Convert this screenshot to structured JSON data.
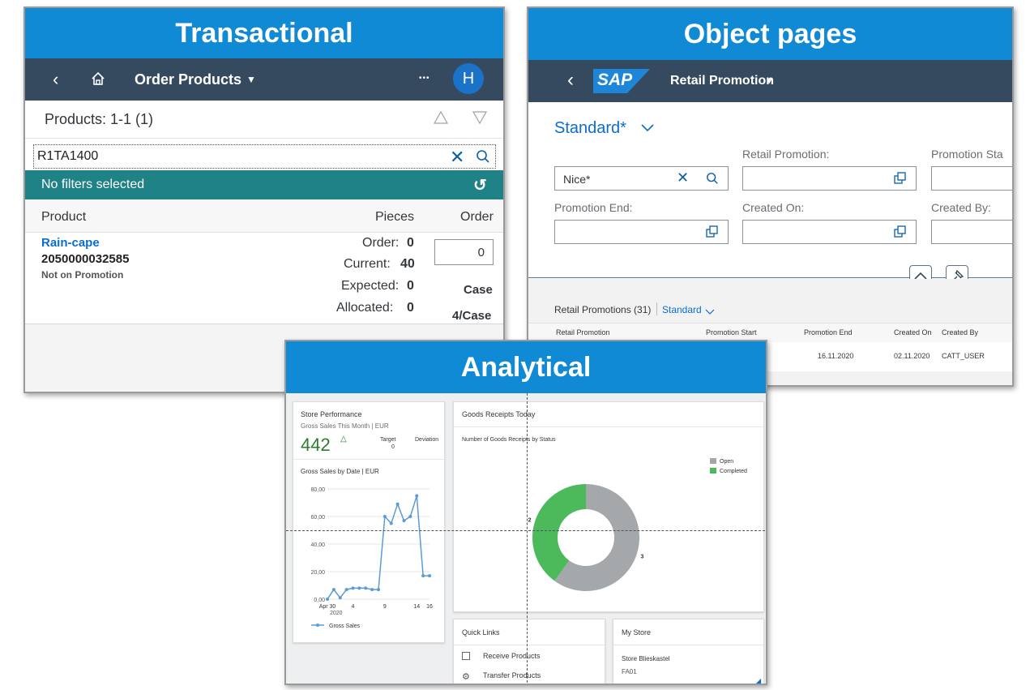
{
  "transactional": {
    "banner": "Transactional",
    "shell": {
      "title": "Order Products",
      "more": "•••",
      "avatar": "H"
    },
    "products_header": "Products: 1-1 (1)",
    "search_value": "R1TA1400",
    "filter_bar": "No filters selected",
    "columns": {
      "product": "Product",
      "pieces": "Pieces",
      "order": "Order"
    },
    "item": {
      "name": "Rain-cape",
      "number": "2050000032585",
      "status": "Not on Promotion",
      "order_label": "Order:",
      "order_value": "0",
      "current_label": "Current:",
      "current_value": "40",
      "expected_label": "Expected:",
      "expected_value": "0",
      "allocated_label": "Allocated:",
      "allocated_value": "0",
      "order_input": "0",
      "unit": "Case",
      "pack": "4/Case"
    }
  },
  "object_pages": {
    "banner": "Object pages",
    "shell": {
      "logo": "SAP",
      "title": "Retail Promotion"
    },
    "variant": "Standard*",
    "labels": {
      "retail_promotion": "Retail Promotion:",
      "promotion_start": "Promotion Sta",
      "promotion_end": "Promotion End:",
      "created_on": "Created On:",
      "created_by": "Created By:"
    },
    "search_value": "Nice*",
    "table_title": "Retail Promotions (31)",
    "table_variant": "Standard",
    "columns": [
      "Retail Promotion",
      "Promotion Start",
      "Promotion End",
      "Created On",
      "Created By"
    ],
    "row": {
      "promotion_end": "16.11.2020",
      "created_on": "02.11.2020",
      "created_by": "CATT_USER"
    }
  },
  "analytical": {
    "banner": "Analytical",
    "store_performance": {
      "title": "Store Performance",
      "subtitle": "Gross Sales This Month | EUR",
      "kpi": "442",
      "target_label": "Target",
      "target_value": "0",
      "deviation_label": "Deviation",
      "kpi_color": "#2b7d2b"
    },
    "line_chart_title": "Gross Sales by Date | EUR",
    "goods_receipts": {
      "title": "Goods Receipts Today",
      "subtitle": "Number of Goods Receipts by Status"
    },
    "quick_links": {
      "title": "Quick Links",
      "items": [
        "Receive Products",
        "Transfer Products"
      ]
    },
    "my_store": {
      "title": "My Store",
      "name": "Store Blieskastel",
      "code": "FA01"
    }
  },
  "chart_data": [
    {
      "type": "line",
      "title": "Gross Sales by Date | EUR",
      "xlabel": "",
      "ylabel": "",
      "ylim": [
        0,
        80
      ],
      "y_ticks": [
        "80,00",
        "60,00",
        "40,00",
        "20,00",
        "0,00"
      ],
      "x_tick_labels": [
        "Apr 30",
        "4",
        "9",
        "14",
        "16"
      ],
      "x_tick_sub": "2020",
      "x_tick_positions": [
        0,
        4,
        9,
        14,
        16
      ],
      "legend": [
        "Gross Sales"
      ],
      "legend_position": "bottom",
      "series": [
        {
          "name": "Gross Sales",
          "color": "#5b9bd5",
          "x": [
            0,
            1,
            2,
            3,
            4,
            5,
            6,
            7,
            8,
            9,
            10,
            11,
            12,
            13,
            14,
            15,
            16
          ],
          "values": [
            0,
            7,
            1,
            7,
            8,
            8,
            8,
            7,
            7,
            60,
            55,
            69,
            57,
            60,
            75,
            17,
            17
          ]
        }
      ]
    },
    {
      "type": "pie",
      "title": "Number of Goods Receipts by Status",
      "donut": true,
      "categories": [
        "Open",
        "Completed"
      ],
      "values": [
        3,
        2
      ],
      "colors": [
        "#a5a8ab",
        "#4cba5b"
      ],
      "legend_position": "top-right"
    }
  ]
}
